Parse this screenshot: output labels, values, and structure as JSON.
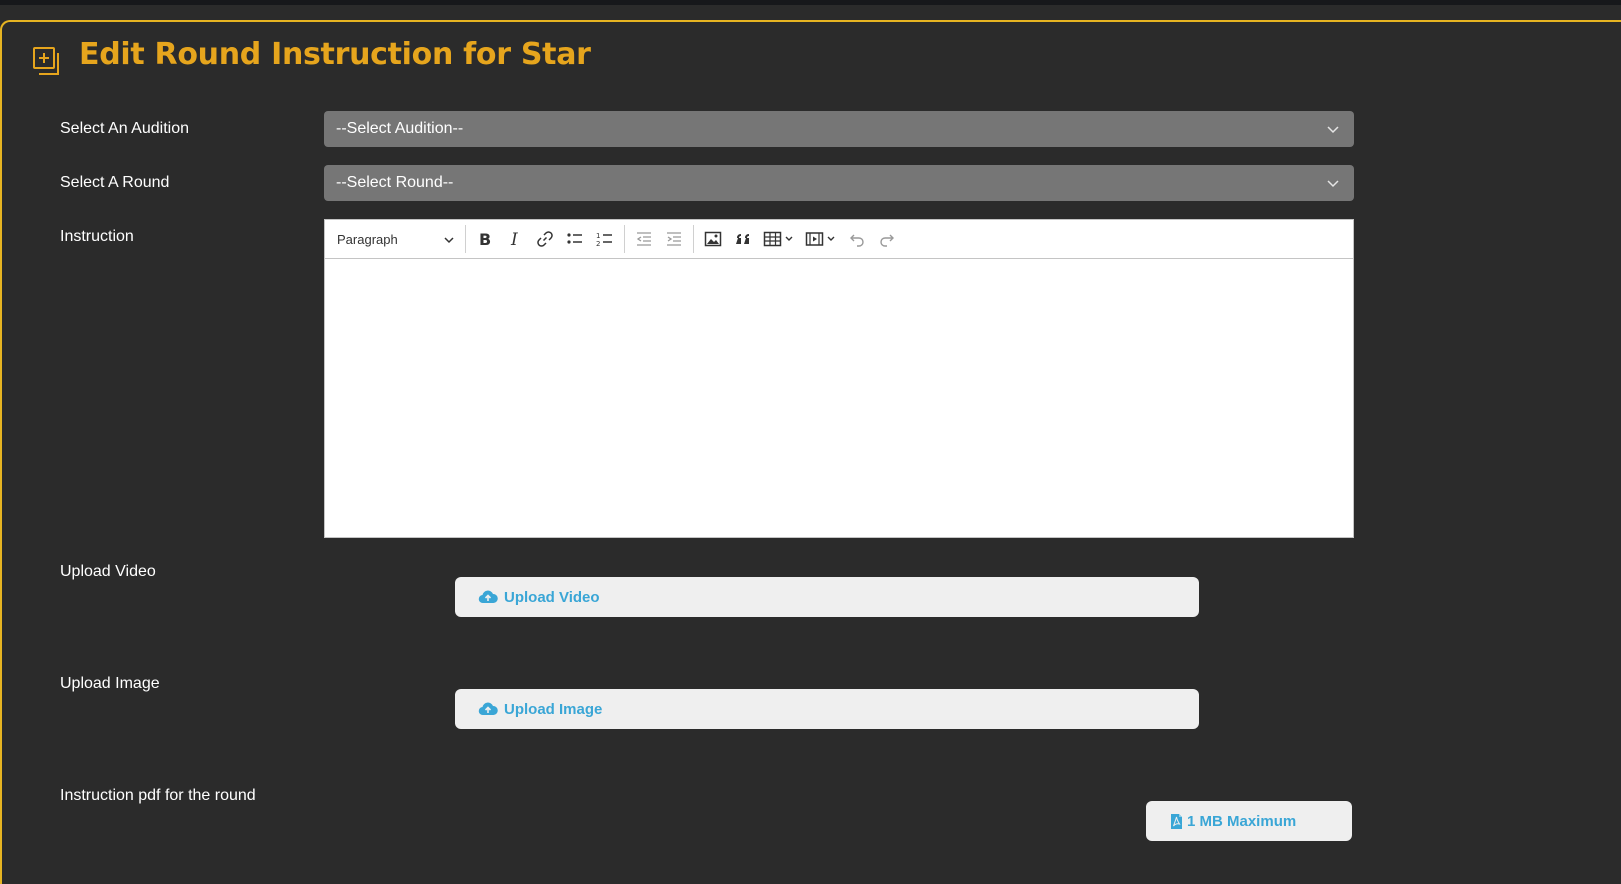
{
  "page": {
    "title": "Edit Round Instruction for Star",
    "accent_color": "#e6a51d",
    "border_color": "#e6b422"
  },
  "form": {
    "audition": {
      "label": "Select An Audition",
      "selected": "--Select Audition--"
    },
    "round": {
      "label": "Select A Round",
      "selected": "--Select Round--"
    },
    "instruction": {
      "label": "Instruction",
      "heading_dropdown": "Paragraph",
      "toolbar_icons": [
        "bold-icon",
        "italic-icon",
        "link-icon",
        "bulleted-list-icon",
        "numbered-list-icon",
        "outdent-icon",
        "indent-icon",
        "image-icon",
        "blockquote-icon",
        "table-icon",
        "media-icon",
        "undo-icon",
        "redo-icon"
      ],
      "content": ""
    },
    "video": {
      "label": "Upload Video",
      "button": "Upload Video",
      "icon": "cloud-upload-icon"
    },
    "image": {
      "label": "Upload Image",
      "button": "Upload Image",
      "icon": "cloud-upload-icon"
    },
    "pdf": {
      "label": "Instruction pdf for the round",
      "button": "1 MB Maximum",
      "icon": "pdf-file-icon"
    }
  }
}
